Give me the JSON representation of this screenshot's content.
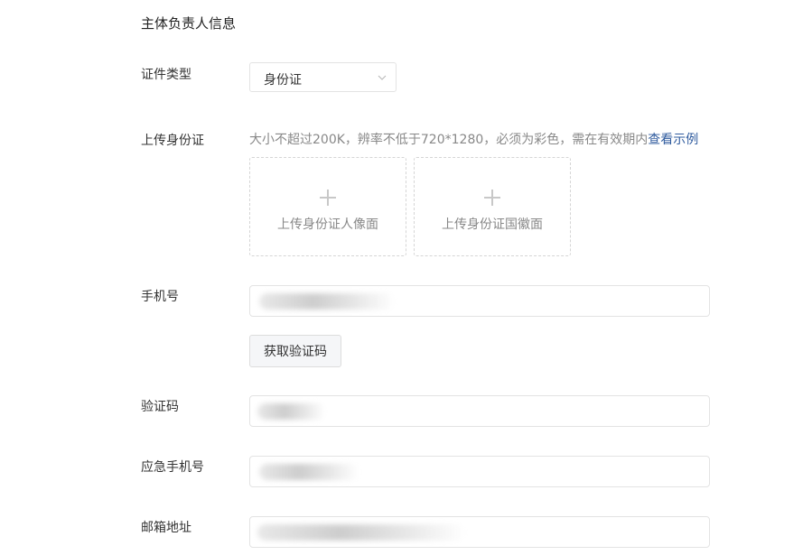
{
  "section": {
    "title": "主体负责人信息"
  },
  "id_type": {
    "label": "证件类型",
    "selected": "身份证"
  },
  "upload": {
    "label": "上传身份证",
    "hint": "大小不超过200K，辨率不低于720*1280，必须为彩色，需在有效期内",
    "example_link": "查看示例",
    "front_caption": "上传身份证人像面",
    "back_caption": "上传身份证国徽面"
  },
  "phone": {
    "label": "手机号",
    "get_code_button": "获取验证码"
  },
  "verification_code": {
    "label": "验证码"
  },
  "emergency_phone": {
    "label": "应急手机号"
  },
  "email": {
    "label": "邮箱地址"
  },
  "icons": {
    "select_arrow": "chevron-down-icon",
    "upload": "plus-icon"
  },
  "colors": {
    "link": "#2f5b9e",
    "border": "#e3e3e3",
    "hint_text": "#888888"
  }
}
